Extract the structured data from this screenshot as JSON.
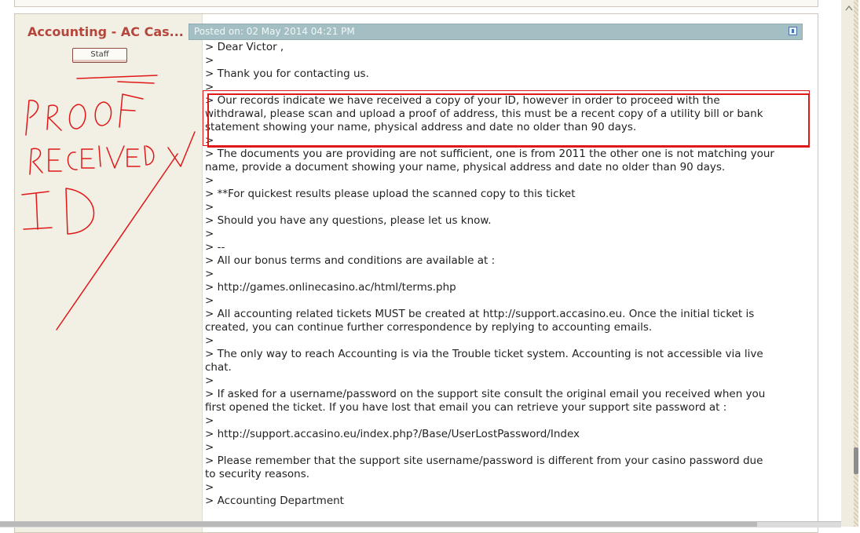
{
  "post": {
    "author": "Accounting - AC Cas...",
    "badge": "Staff",
    "posted_on": "Posted on: 02 May 2014 04:21 PM",
    "report_icon": "report-icon"
  },
  "message_lines": [
    "> Dear Victor ,",
    ">",
    "> Thank you for contacting us.",
    ">",
    "> Our records indicate we have received a copy of your ID, however in order to proceed with the",
    "withdrawal, please scan and upload a proof of address, this must be a recent copy of a utility bill or bank",
    "statement showing your name, physical address and date no older than 90 days.",
    ">",
    "> The documents you are providing are not sufficient, one is from 2011 the other one is not matching your",
    "name, provide a document showing your name, physical address and date no older than 90 days.",
    ">",
    "> **For quickest results please upload the scanned copy to this ticket",
    ">",
    "> Should you have any questions, please let us know.",
    ">",
    "> --",
    "> All our bonus terms and conditions are available at :",
    ">",
    "> http://games.onlinecasino.ac/html/terms.php",
    ">",
    "> All accounting related tickets MUST be created at http://support.accasino.eu. Once the initial ticket is",
    "created, you can continue further correspondence by replying to accounting emails.",
    ">",
    "> The only way to reach Accounting is via the Trouble ticket system. Accounting is not accessible via live",
    "chat.",
    ">",
    "> If asked for a username/password on the support site consult the original email you received when you",
    "first opened the ticket. If you have lost that email you can retrieve your support site password at :",
    ">",
    "> http://support.accasino.eu/index.php?/Base/UserLostPassword/Index",
    ">",
    "> Please remember that the support site username/password is different from your casino password due",
    "to security reasons.",
    ">",
    "> Accounting Department"
  ],
  "colors": {
    "accent": "#b5463c",
    "header_bar": "#a3bfc4",
    "annotation_red": "#e01818"
  }
}
